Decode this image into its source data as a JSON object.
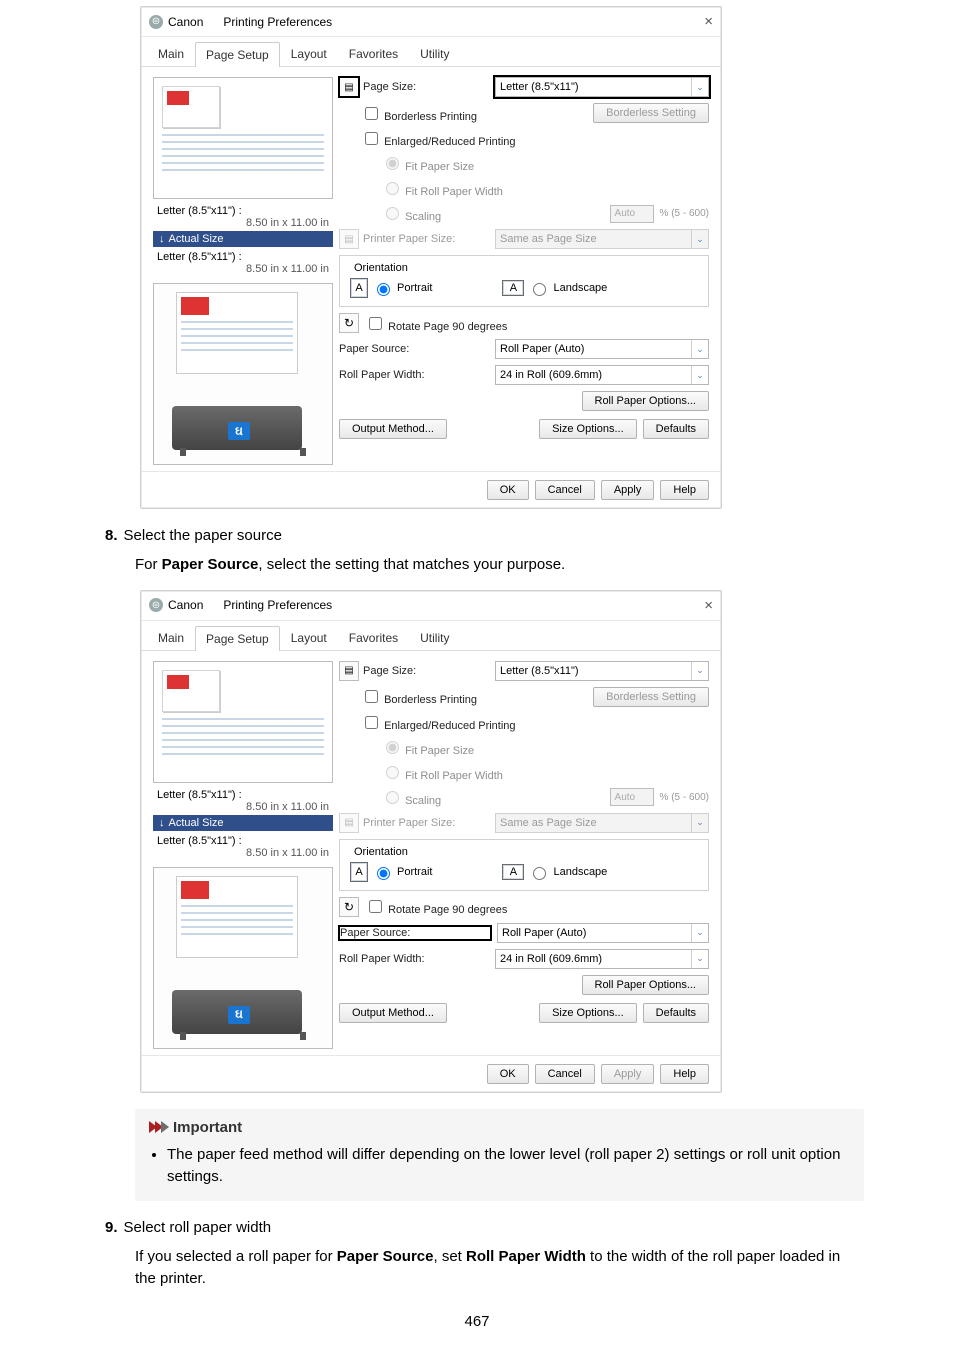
{
  "step8": {
    "num": "8.",
    "title": "Select the paper source",
    "text_pre": "For ",
    "bold": "Paper Source",
    "text_post": ", select the setting that matches your purpose."
  },
  "step9": {
    "num": "9.",
    "title": "Select roll paper width",
    "pre": "If you selected a roll paper for ",
    "b1": "Paper Source",
    "mid": ", set ",
    "b2": "Roll Paper Width",
    "post": " to the width of the roll paper loaded in the printer."
  },
  "important": {
    "label": "Important",
    "bullet": "The paper feed method will differ depending on the lower level (roll paper 2) settings or roll unit option settings."
  },
  "dialog": {
    "title_brand": "Canon",
    "title_rest": "Printing Preferences",
    "close": "×",
    "tabs": [
      "Main",
      "Page Setup",
      "Layout",
      "Favorites",
      "Utility"
    ],
    "preview": {
      "label": "Letter (8.5\"x11\") :",
      "dim": "8.50 in x 11.00 in",
      "actual": "Actual Size",
      "label2": "Letter (8.5\"x11\") :",
      "dim2": "8.50 in x 11.00 in"
    },
    "page_size_lbl": "Page Size:",
    "page_size_val": "Letter (8.5\"x11\")",
    "borderless": {
      "chk": "Borderless Printing",
      "btn": "Borderless Setting"
    },
    "enlarged": "Enlarged/Reduced Printing",
    "fit_paper": "Fit Paper Size",
    "fit_roll": "Fit Roll Paper Width",
    "scaling": "Scaling",
    "scaling_val": "Auto",
    "scaling_unit": "%  (5 - 600)",
    "printer_paper_lbl": "Printer Paper Size:",
    "printer_paper_val": "Same as Page Size",
    "orientation": {
      "legend": "Orientation",
      "portrait": "Portrait",
      "landscape": "Landscape",
      "rotate": "Rotate Page 90 degrees"
    },
    "paper_source_lbl": "Paper Source:",
    "paper_source_val": "Roll Paper (Auto)",
    "roll_width_lbl": "Roll Paper Width:",
    "roll_width_val": "24 in Roll (609.6mm)",
    "roll_options": "Roll Paper Options...",
    "output_method": "Output Method...",
    "size_options": "Size Options...",
    "defaults": "Defaults",
    "ok": "OK",
    "cancel": "Cancel",
    "apply": "Apply",
    "help": "Help"
  },
  "pageno": "467"
}
